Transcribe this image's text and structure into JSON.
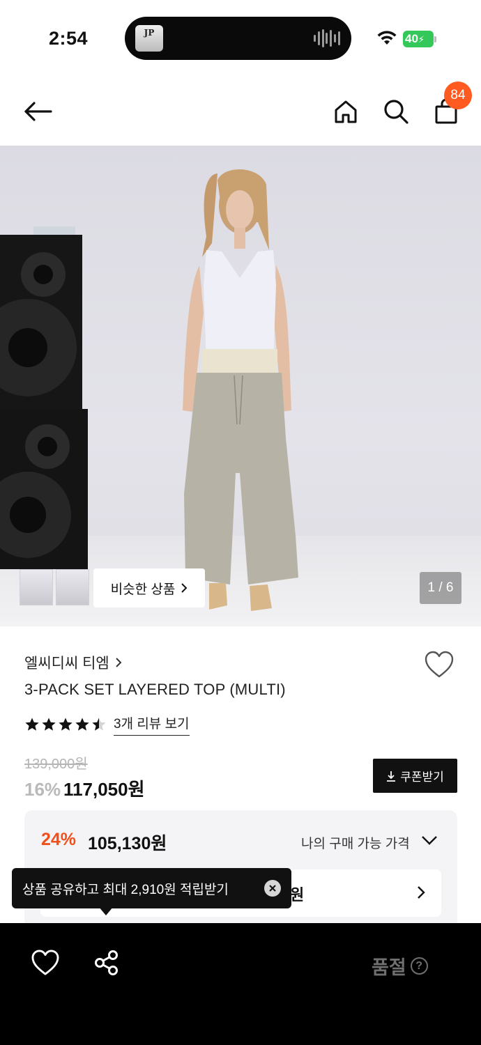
{
  "status_bar": {
    "time": "2:54",
    "battery": "40",
    "island_thumb_text": "JP"
  },
  "header": {
    "cart_count": "84",
    "icons": [
      "back-arrow-icon",
      "home-icon",
      "search-icon",
      "shopping-bag-icon"
    ]
  },
  "gallery": {
    "similar_label": "비슷한 상품",
    "page_indicator": "1 / 6"
  },
  "product": {
    "brand": "엘씨디씨 티엠",
    "name": "3-PACK SET LAYERED TOP (MULTI)",
    "rating": 4.5,
    "review_link": "3개 리뷰 보기",
    "original_price": "139,000원",
    "discount": "16%",
    "price": "117,050원",
    "coupon_label": "쿠폰받기"
  },
  "best_price": {
    "discount": "24%",
    "price": "105,130원",
    "my_price_label": "나의 구매 가능 가격",
    "inner_value": "원"
  },
  "tooltip": {
    "text": "상품 공유하고 최대 2,910원 적립받기"
  },
  "bottom_bar": {
    "soldout_label": "품절",
    "help_glyph": "?"
  },
  "colors": {
    "accent": "#f0511a",
    "badge": "#ff5a1f",
    "battery": "#34c759"
  }
}
